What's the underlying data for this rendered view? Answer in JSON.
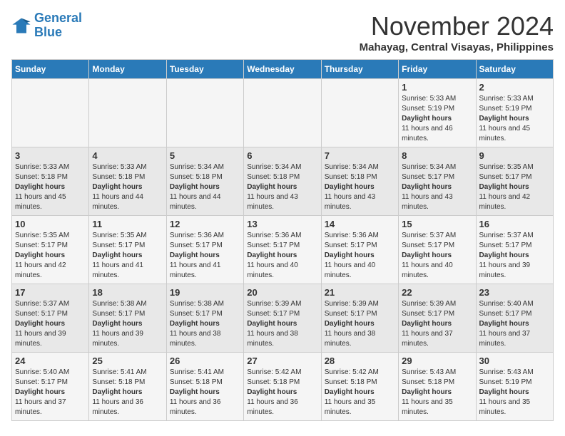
{
  "header": {
    "logo_line1": "General",
    "logo_line2": "Blue",
    "month_title": "November 2024",
    "location": "Mahayag, Central Visayas, Philippines"
  },
  "days_of_week": [
    "Sunday",
    "Monday",
    "Tuesday",
    "Wednesday",
    "Thursday",
    "Friday",
    "Saturday"
  ],
  "weeks": [
    [
      {
        "day": "",
        "info": ""
      },
      {
        "day": "",
        "info": ""
      },
      {
        "day": "",
        "info": ""
      },
      {
        "day": "",
        "info": ""
      },
      {
        "day": "",
        "info": ""
      },
      {
        "day": "1",
        "info": "Sunrise: 5:33 AM\nSunset: 5:19 PM\nDaylight: 11 hours and 46 minutes."
      },
      {
        "day": "2",
        "info": "Sunrise: 5:33 AM\nSunset: 5:19 PM\nDaylight: 11 hours and 45 minutes."
      }
    ],
    [
      {
        "day": "3",
        "info": "Sunrise: 5:33 AM\nSunset: 5:18 PM\nDaylight: 11 hours and 45 minutes."
      },
      {
        "day": "4",
        "info": "Sunrise: 5:33 AM\nSunset: 5:18 PM\nDaylight: 11 hours and 44 minutes."
      },
      {
        "day": "5",
        "info": "Sunrise: 5:34 AM\nSunset: 5:18 PM\nDaylight: 11 hours and 44 minutes."
      },
      {
        "day": "6",
        "info": "Sunrise: 5:34 AM\nSunset: 5:18 PM\nDaylight: 11 hours and 43 minutes."
      },
      {
        "day": "7",
        "info": "Sunrise: 5:34 AM\nSunset: 5:18 PM\nDaylight: 11 hours and 43 minutes."
      },
      {
        "day": "8",
        "info": "Sunrise: 5:34 AM\nSunset: 5:17 PM\nDaylight: 11 hours and 43 minutes."
      },
      {
        "day": "9",
        "info": "Sunrise: 5:35 AM\nSunset: 5:17 PM\nDaylight: 11 hours and 42 minutes."
      }
    ],
    [
      {
        "day": "10",
        "info": "Sunrise: 5:35 AM\nSunset: 5:17 PM\nDaylight: 11 hours and 42 minutes."
      },
      {
        "day": "11",
        "info": "Sunrise: 5:35 AM\nSunset: 5:17 PM\nDaylight: 11 hours and 41 minutes."
      },
      {
        "day": "12",
        "info": "Sunrise: 5:36 AM\nSunset: 5:17 PM\nDaylight: 11 hours and 41 minutes."
      },
      {
        "day": "13",
        "info": "Sunrise: 5:36 AM\nSunset: 5:17 PM\nDaylight: 11 hours and 40 minutes."
      },
      {
        "day": "14",
        "info": "Sunrise: 5:36 AM\nSunset: 5:17 PM\nDaylight: 11 hours and 40 minutes."
      },
      {
        "day": "15",
        "info": "Sunrise: 5:37 AM\nSunset: 5:17 PM\nDaylight: 11 hours and 40 minutes."
      },
      {
        "day": "16",
        "info": "Sunrise: 5:37 AM\nSunset: 5:17 PM\nDaylight: 11 hours and 39 minutes."
      }
    ],
    [
      {
        "day": "17",
        "info": "Sunrise: 5:37 AM\nSunset: 5:17 PM\nDaylight: 11 hours and 39 minutes."
      },
      {
        "day": "18",
        "info": "Sunrise: 5:38 AM\nSunset: 5:17 PM\nDaylight: 11 hours and 39 minutes."
      },
      {
        "day": "19",
        "info": "Sunrise: 5:38 AM\nSunset: 5:17 PM\nDaylight: 11 hours and 38 minutes."
      },
      {
        "day": "20",
        "info": "Sunrise: 5:39 AM\nSunset: 5:17 PM\nDaylight: 11 hours and 38 minutes."
      },
      {
        "day": "21",
        "info": "Sunrise: 5:39 AM\nSunset: 5:17 PM\nDaylight: 11 hours and 38 minutes."
      },
      {
        "day": "22",
        "info": "Sunrise: 5:39 AM\nSunset: 5:17 PM\nDaylight: 11 hours and 37 minutes."
      },
      {
        "day": "23",
        "info": "Sunrise: 5:40 AM\nSunset: 5:17 PM\nDaylight: 11 hours and 37 minutes."
      }
    ],
    [
      {
        "day": "24",
        "info": "Sunrise: 5:40 AM\nSunset: 5:17 PM\nDaylight: 11 hours and 37 minutes."
      },
      {
        "day": "25",
        "info": "Sunrise: 5:41 AM\nSunset: 5:18 PM\nDaylight: 11 hours and 36 minutes."
      },
      {
        "day": "26",
        "info": "Sunrise: 5:41 AM\nSunset: 5:18 PM\nDaylight: 11 hours and 36 minutes."
      },
      {
        "day": "27",
        "info": "Sunrise: 5:42 AM\nSunset: 5:18 PM\nDaylight: 11 hours and 36 minutes."
      },
      {
        "day": "28",
        "info": "Sunrise: 5:42 AM\nSunset: 5:18 PM\nDaylight: 11 hours and 35 minutes."
      },
      {
        "day": "29",
        "info": "Sunrise: 5:43 AM\nSunset: 5:18 PM\nDaylight: 11 hours and 35 minutes."
      },
      {
        "day": "30",
        "info": "Sunrise: 5:43 AM\nSunset: 5:19 PM\nDaylight: 11 hours and 35 minutes."
      }
    ]
  ]
}
